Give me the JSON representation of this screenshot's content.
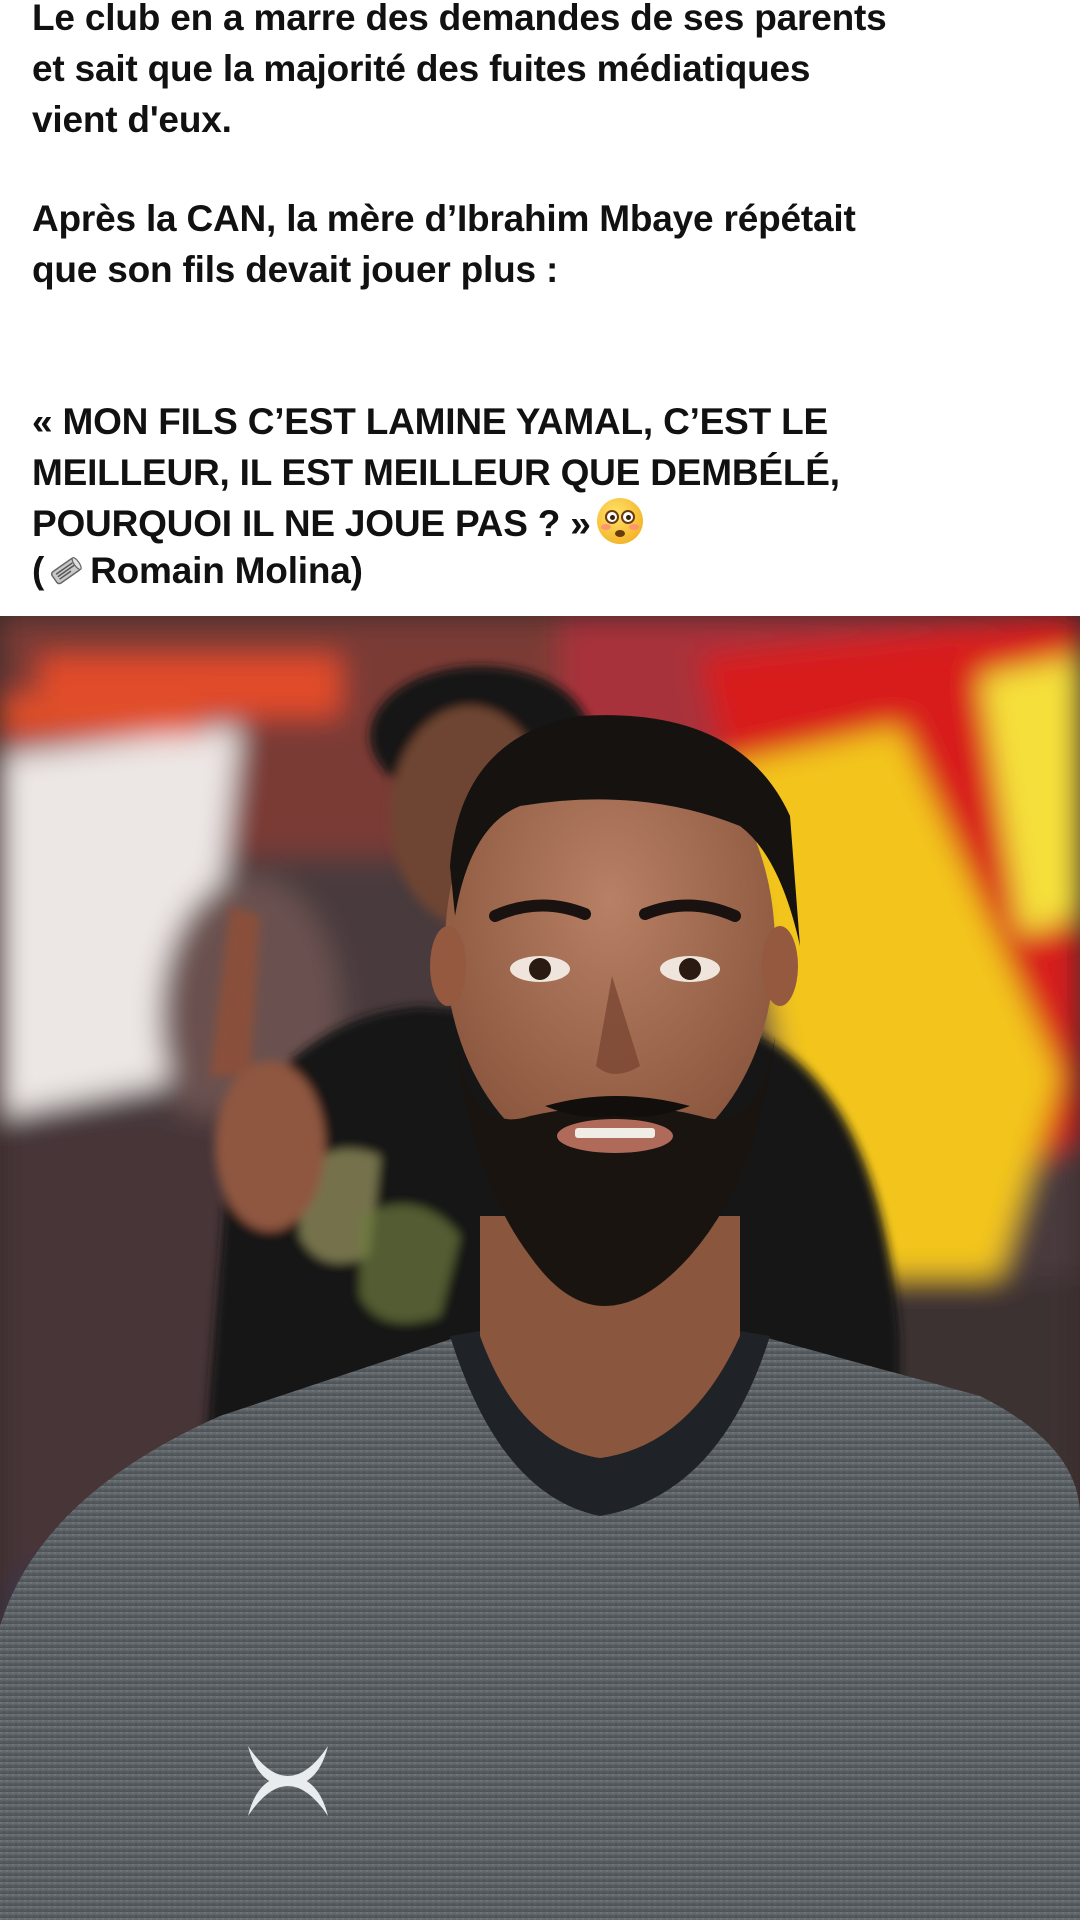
{
  "post": {
    "paragraph_1": "Le club en a marre des demandes de ses parents\net sait que la majorité des fuites médiatiques\nvient d'eux.",
    "paragraph_2": "Après la CAN, la mère d’Ibrahim Mbaye répétait\nque son fils devait jouer plus :",
    "paragraph_3": "« MON FILS C’EST LAMINE YAMAL, C’EST LE\nMEILLEUR, IL EST MEILLEUR QUE DEMBÉLÉ,\nPOURQUOI IL NE JOUE PAS ? »",
    "quote_emoji": "flushed-face-emoji",
    "source_open": "(",
    "source_icon": "rolled-newspaper-icon",
    "source_name": " Romain Molina)"
  },
  "photo": {
    "subject": "man-in-grey-sports-shirt-icon",
    "background_colors": {
      "flag_red": "#d81e1e",
      "flag_yellow": "#f3c51a",
      "shirt_grey": "#5f6468"
    }
  }
}
